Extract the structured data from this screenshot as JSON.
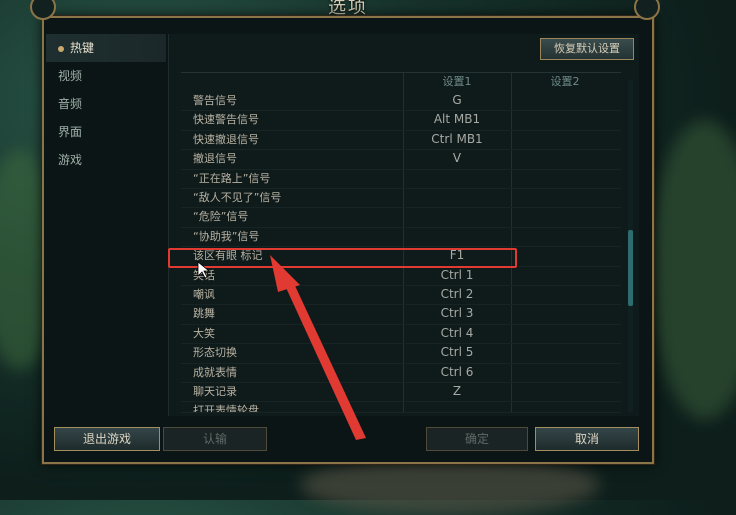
{
  "window": {
    "title": "选项"
  },
  "sidebar": {
    "items": [
      {
        "label": "热键"
      },
      {
        "label": "视频"
      },
      {
        "label": "音频"
      },
      {
        "label": "界面"
      },
      {
        "label": "游戏"
      }
    ]
  },
  "content": {
    "reset_button": "恢复默认设置",
    "columns": {
      "setting1": "设置1",
      "setting2": "设置2"
    },
    "rows": [
      {
        "label": "警告信号",
        "key1": "G",
        "key2": ""
      },
      {
        "label": "快速警告信号",
        "key1": "Alt  MB1",
        "key2": ""
      },
      {
        "label": "快速撤退信号",
        "key1": "Ctrl  MB1",
        "key2": ""
      },
      {
        "label": "撤退信号",
        "key1": "V",
        "key2": ""
      },
      {
        "label": "“正在路上”信号",
        "key1": "",
        "key2": ""
      },
      {
        "label": "“敌人不见了”信号",
        "key1": "",
        "key2": ""
      },
      {
        "label": "“危险”信号",
        "key1": "",
        "key2": ""
      },
      {
        "label": "“协助我”信号",
        "key1": "",
        "key2": ""
      },
      {
        "label": "该区有眼 标记",
        "key1": "F1",
        "key2": ""
      },
      {
        "label": "笑话",
        "key1": "Ctrl  1",
        "key2": ""
      },
      {
        "label": "嘲讽",
        "key1": "Ctrl  2",
        "key2": ""
      },
      {
        "label": "跳舞",
        "key1": "Ctrl  3",
        "key2": ""
      },
      {
        "label": "大笑",
        "key1": "Ctrl  4",
        "key2": ""
      },
      {
        "label": "形态切换",
        "key1": "Ctrl  5",
        "key2": ""
      },
      {
        "label": "成就表情",
        "key1": "Ctrl  6",
        "key2": ""
      },
      {
        "label": "聊天记录",
        "key1": "Z",
        "key2": ""
      },
      {
        "label": "打开表情轮盘",
        "key1": "",
        "key2": ""
      }
    ]
  },
  "footer": {
    "exit_game": "退出游戏",
    "surrender": "认输",
    "confirm": "确定",
    "cancel": "取消"
  },
  "colors": {
    "highlight_box": "#e03a32",
    "arrow": "#e03a32",
    "gold_border": "#9a8656"
  }
}
